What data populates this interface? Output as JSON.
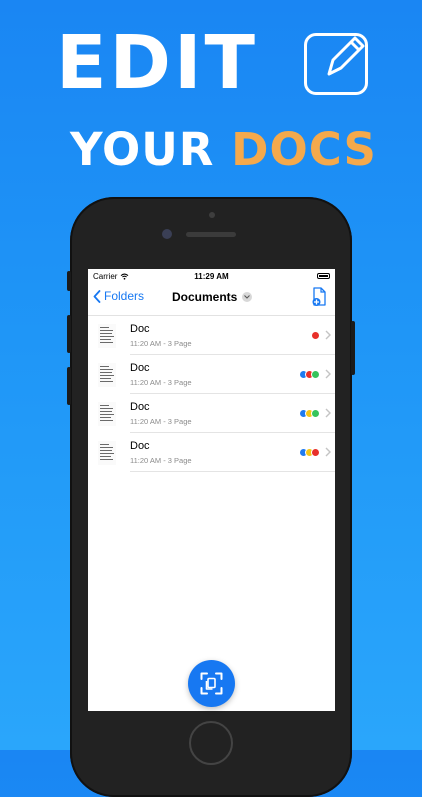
{
  "promo": {
    "line1": "EDIT",
    "line2_a": "YOUR ",
    "line2_b": "DOCS",
    "accent_color": "#f4a94c"
  },
  "status_bar": {
    "carrier": "Carrier",
    "time": "11:29 AM"
  },
  "nav": {
    "back_label": "Folders",
    "title": "Documents",
    "new_doc_icon": "new-document-icon"
  },
  "documents": [
    {
      "name": "Doc",
      "meta": "11:20 AM - 3 Page",
      "tags": [
        "#e8302a"
      ]
    },
    {
      "name": "Doc",
      "meta": "11:20 AM - 3 Page",
      "tags": [
        "#1f7bf0",
        "#e8302a",
        "#36c45b"
      ]
    },
    {
      "name": "Doc",
      "meta": "11:20 AM - 3 Page",
      "tags": [
        "#1f7bf0",
        "#f5c518",
        "#36c45b"
      ]
    },
    {
      "name": "Doc",
      "meta": "11:20 AM - 3 Page",
      "tags": [
        "#1f7bf0",
        "#f5c518",
        "#e8302a"
      ]
    }
  ],
  "fab": {
    "icon": "scan-document-icon"
  }
}
